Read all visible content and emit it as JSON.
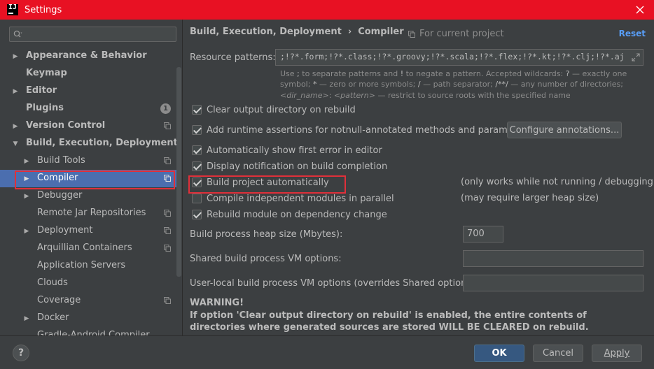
{
  "window": {
    "app_logo": "IJ",
    "title": "Settings"
  },
  "sidebar": {
    "search": {
      "value": "",
      "placeholder": ""
    },
    "items": [
      {
        "label": "Appearance & Behavior",
        "bold": true,
        "expandable": true,
        "expanded": false,
        "level": 0
      },
      {
        "label": "Keymap",
        "bold": true,
        "expandable": false,
        "level": 0
      },
      {
        "label": "Editor",
        "bold": true,
        "expandable": true,
        "expanded": false,
        "level": 0
      },
      {
        "label": "Plugins",
        "bold": true,
        "expandable": false,
        "level": 0,
        "badge": "1"
      },
      {
        "label": "Version Control",
        "bold": true,
        "expandable": true,
        "expanded": false,
        "level": 0,
        "project_icon": true
      },
      {
        "label": "Build, Execution, Deployment",
        "bold": true,
        "expandable": true,
        "expanded": true,
        "level": 0
      },
      {
        "label": "Build Tools",
        "expandable": true,
        "expanded": false,
        "level": 1,
        "project_icon": true
      },
      {
        "label": "Compiler",
        "expandable": true,
        "expanded": false,
        "level": 1,
        "project_icon": true,
        "selected": true
      },
      {
        "label": "Debugger",
        "expandable": true,
        "expanded": false,
        "level": 1
      },
      {
        "label": "Remote Jar Repositories",
        "expandable": false,
        "level": 1,
        "project_icon": true
      },
      {
        "label": "Deployment",
        "expandable": true,
        "expanded": false,
        "level": 1,
        "project_icon": true
      },
      {
        "label": "Arquillian Containers",
        "expandable": false,
        "level": 1,
        "project_icon": true
      },
      {
        "label": "Application Servers",
        "expandable": false,
        "level": 1
      },
      {
        "label": "Clouds",
        "expandable": false,
        "level": 1
      },
      {
        "label": "Coverage",
        "expandable": false,
        "level": 1,
        "project_icon": true
      },
      {
        "label": "Docker",
        "expandable": true,
        "expanded": false,
        "level": 1
      },
      {
        "label": "Gradle-Android Compiler",
        "expandable": false,
        "level": 1
      }
    ]
  },
  "header": {
    "breadcrumb": [
      "Build, Execution, Deployment",
      "Compiler"
    ],
    "breadcrumb_sep": "›",
    "scope": "For current project",
    "reset": "Reset"
  },
  "compiler": {
    "resource_patterns_label": "Resource patterns:",
    "resource_patterns_value": ";!?*.form;!?*.class;!?*.groovy;!?*.scala;!?*.flex;!?*.kt;!?*.clj;!?*.aj",
    "hint": {
      "p1": "Use ",
      "k1": ";",
      "p2": " to separate patterns and ",
      "k2": "!",
      "p3": " to negate a pattern. Accepted wildcards: ",
      "k3": "?",
      "p4": " — exactly one symbol; ",
      "k4": "*",
      "p5": " — zero or more symbols; ",
      "k5": "/",
      "p6": " — path separator; ",
      "k6": "/**/",
      "p7": " — any number of directories; ",
      "i1": "<dir_name>",
      "p8": ":",
      "i2": "<pattern>",
      "p9": " — restrict to source roots with the specified name"
    },
    "checkboxes": [
      {
        "label": "Clear output directory on rebuild",
        "checked": true
      },
      {
        "label": "Add runtime assertions for notnull-annotated methods and parameters",
        "checked": true
      },
      {
        "label": "Automatically show first error in editor",
        "checked": true
      },
      {
        "label": "Display notification on build completion",
        "checked": true
      },
      {
        "label": "Build project automatically",
        "checked": true,
        "note": "(only works while not running / debugging)"
      },
      {
        "label": "Compile independent modules in parallel",
        "checked": false,
        "note": "(may require larger heap size)"
      },
      {
        "label": "Rebuild module on dependency change",
        "checked": true
      }
    ],
    "configure_annotations": "Configure annotations...",
    "heap_size_label": "Build process heap size (Mbytes):",
    "heap_size_value": "700",
    "shared_vm_label": "Shared build process VM options:",
    "shared_vm_value": "",
    "user_vm_label": "User-local build process VM options (overrides Shared options):",
    "user_vm_value": "",
    "warning_title": "WARNING!",
    "warning_text": "If option 'Clear output directory on rebuild' is enabled, the entire contents of directories where generated sources are stored WILL BE CLEARED on rebuild."
  },
  "footer": {
    "help": "?",
    "ok": "OK",
    "cancel": "Cancel",
    "apply": "Apply"
  },
  "colors": {
    "titlebar": "#e81123",
    "background": "#3c3f41",
    "selection": "#4b6eaf",
    "link": "#589df6",
    "highlight_box": "#e0303a",
    "primary_button": "#365880"
  }
}
